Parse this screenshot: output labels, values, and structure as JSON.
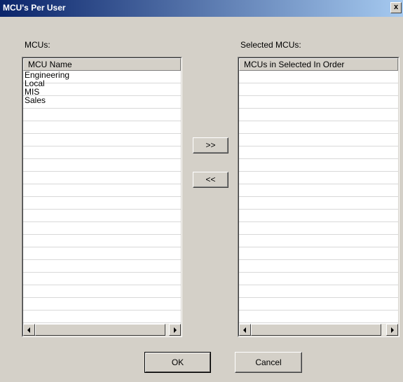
{
  "window": {
    "title": "MCU's Per User",
    "close_label": "x"
  },
  "left": {
    "label": "MCUs:",
    "column_header": "MCU Name",
    "items": [
      "Engineering",
      "Local",
      "MIS",
      "Sales"
    ]
  },
  "right": {
    "label": "Selected MCUs:",
    "column_header": "MCUs in Selected In Order",
    "items": []
  },
  "transfer": {
    "add_label": ">>",
    "remove_label": "<<"
  },
  "footer": {
    "ok_label": "OK",
    "cancel_label": "Cancel"
  }
}
